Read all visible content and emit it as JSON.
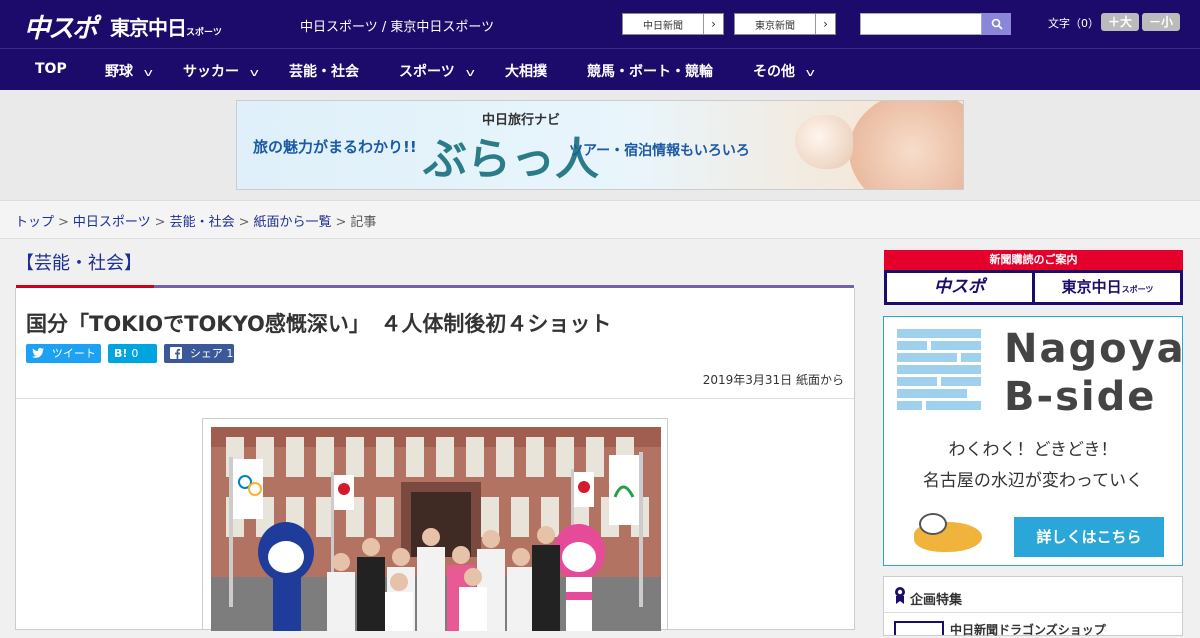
{
  "header": {
    "logo_main": "中スポ",
    "logo_tokyo": "東京中日",
    "logo_tokyo_sub": "スポーツ",
    "site_links": "中日スポーツ / 東京中日スポーツ",
    "ext_links": [
      {
        "label": "中日新聞"
      },
      {
        "label": "東京新聞"
      }
    ],
    "search_placeholder": "",
    "font_size_label": "文字（0）",
    "font_plus": "＋大",
    "font_minus": "－小"
  },
  "nav": {
    "items": [
      {
        "label": "TOP",
        "has_dropdown": false
      },
      {
        "label": "野球",
        "has_dropdown": true
      },
      {
        "label": "サッカー",
        "has_dropdown": true
      },
      {
        "label": "芸能・社会",
        "has_dropdown": false
      },
      {
        "label": "スポーツ",
        "has_dropdown": true
      },
      {
        "label": "大相撲",
        "has_dropdown": false
      },
      {
        "label": "競馬・ボート・競輪",
        "has_dropdown": false
      },
      {
        "label": "その他",
        "has_dropdown": true
      }
    ]
  },
  "banner": {
    "lead": "旅の魅力がまるわかり!!",
    "brand_small": "中日旅行ナビ",
    "brand_big": "ぶらっ人",
    "tail": "ツアー・宿泊情報もいろいろ"
  },
  "breadcrumb": {
    "items": [
      "トップ",
      "中日スポーツ",
      "芸能・社会",
      "紙面から一覧",
      "記事"
    ]
  },
  "article": {
    "category": "【芸能・社会】",
    "title": "国分「TOKIOでTOKYO感慨深い」　４人体制後初４ショット",
    "share": {
      "tweet": "ツイート",
      "hatena": "0",
      "facebook": "シェア 1"
    },
    "date": "2019年3月31日 紙面から"
  },
  "sidebar": {
    "subscribe_head": "新聞購読のご案内",
    "subscribe_left": "中スポ",
    "subscribe_right": "東京中日",
    "subscribe_right_sub": "スポーツ",
    "ad_title_1": "Nagoya",
    "ad_title_2": "B-side",
    "ad_copy_1": "わくわく！どきどき！",
    "ad_copy_2": "名古屋の水辺が変わっていく",
    "ad_button": "詳しくはこちら",
    "feature_title": "企画特集",
    "feature_item": "中日新聞ドラゴンズショップ"
  },
  "colors": {
    "header_bg": "#1d0b6b",
    "accent_red": "#d0021b",
    "accent_purple": "#7561a8",
    "link": "#1d2f91",
    "twitter": "#1da1f2",
    "hatena": "#00a4de",
    "facebook": "#3b5998",
    "ad_blue": "#2aa7d8"
  }
}
